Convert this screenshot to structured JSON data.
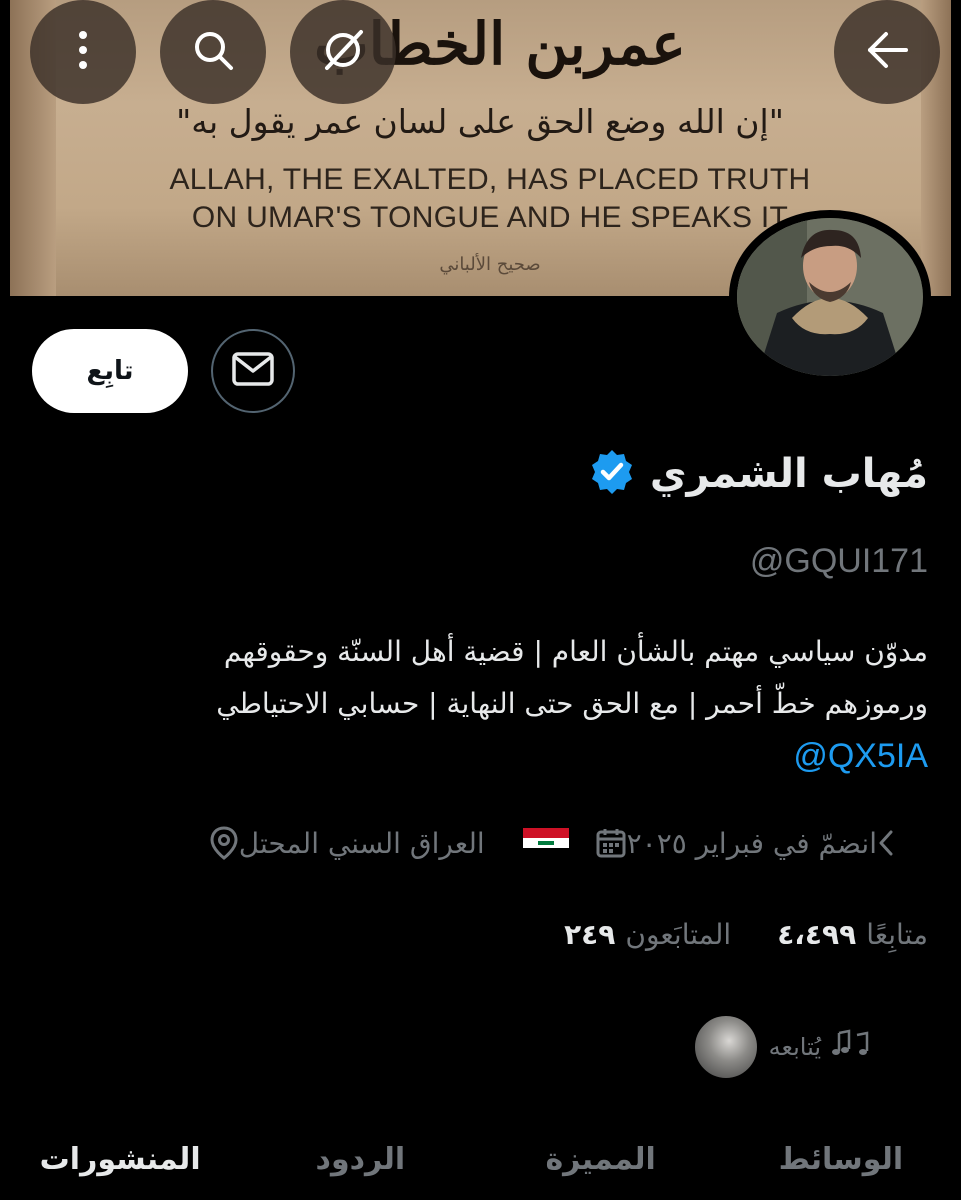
{
  "banner": {
    "calligraphy": "عمربن الخطاب",
    "quote_ar": "\"إن الله وضع الحق على لسان عمر يقول به\"",
    "quote_en_line1": "ALLAH, THE EXALTED, HAS PLACED TRUTH",
    "quote_en_line2": "ON UMAR'S TONGUE AND HE SPEAKS IT",
    "source": "صحيح الألباني"
  },
  "actions": {
    "follow_label": "تابِع"
  },
  "profile": {
    "display_name": "مُهاب الشمري",
    "handle": "@GQUI171",
    "bio_line1": "مدوّن سياسي مهتم بالشأن العام | قضية أهل السنّة وحقوقهم",
    "bio_line2": "ورموزهم خطّ أحمر | مع الحق حتى النهاية | حسابي الاحتياطي",
    "bio_link": "@QX5IA",
    "location": "العراق السني المحتل",
    "joined": "انضمّ في فبراير ٢٠٢٥"
  },
  "stats": {
    "followers_count": "٢٤٩",
    "followers_label": "المتابَعون",
    "following_count": "٤،٤٩٩",
    "following_label": "متابِعًا"
  },
  "followed_by": {
    "text": "يُتابعه"
  },
  "tabs": [
    {
      "label": "المنشورات"
    },
    {
      "label": "الردود"
    },
    {
      "label": "المميزة"
    },
    {
      "label": "الوسائط"
    }
  ],
  "colors": {
    "accent": "#1d9bf0",
    "muted": "#71767b",
    "text": "#e7e9ea",
    "background": "#000000"
  }
}
